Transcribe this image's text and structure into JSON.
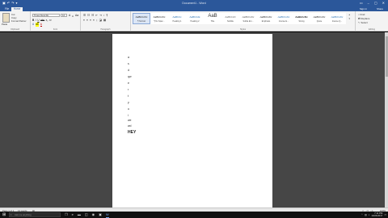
{
  "titlebar": {
    "title": "Document1 - Word",
    "qat_save_icon": "save-icon",
    "qat_undo_icon": "undo-icon",
    "qat_redo_icon": "redo-icon",
    "window_controls": [
      "–",
      "▢",
      "✕"
    ]
  },
  "tabs": {
    "file": "File",
    "home": "Home",
    "sign_in": "Sign in",
    "share": "Share"
  },
  "ribbon": {
    "clipboard": {
      "label": "Clipboard",
      "paste": "Paste",
      "cut": "Cut",
      "copy": "Copy",
      "format_painter": "Format Painter"
    },
    "font": {
      "label": "Font",
      "family": "Times New Ro",
      "size": "12",
      "bold": "B",
      "italic": "I",
      "underline": "U",
      "strike": "abc",
      "sub": "x₂",
      "sup": "x²",
      "text_effects": "A",
      "highlight": "ab",
      "font_color": "A"
    },
    "paragraph": {
      "label": "Paragraph"
    },
    "styles": {
      "label": "Styles",
      "items": [
        {
          "sample": "AaBbCcDc",
          "name": "¶ Normal"
        },
        {
          "sample": "AaBbCcDc",
          "name": "¶ No Spac..."
        },
        {
          "sample": "AaBbCc",
          "name": "Heading 1"
        },
        {
          "sample": "AaBbCcE",
          "name": "Heading 2"
        },
        {
          "sample": "AaB",
          "name": "Title"
        },
        {
          "sample": "AaBbCcD",
          "name": "Subtitle"
        },
        {
          "sample": "AaBbCcDc",
          "name": "Subtle Em..."
        },
        {
          "sample": "AaBbCcDc",
          "name": "Emphasis"
        },
        {
          "sample": "AaBbCcDc",
          "name": "Intense E..."
        },
        {
          "sample": "AaBbCcDc",
          "name": "Strong"
        },
        {
          "sample": "AaBbCcDc",
          "name": "Quote"
        },
        {
          "sample": "AaBbCcDc",
          "name": "Intense Q..."
        }
      ]
    },
    "editing": {
      "label": "Editing",
      "find": "Find",
      "replace": "Replace",
      "select": "Select"
    }
  },
  "document": {
    "lines": [
      "a",
      "s",
      "d",
      "qw",
      "e",
      "r",
      "t",
      "y",
      "u",
      "i",
      "we",
      "wd",
      "HEY"
    ]
  },
  "statusbar": {
    "page": "Page 1 of 1",
    "words": "13 words",
    "proofing_icon": "proofing-icon",
    "zoom": "100%"
  },
  "taskbar": {
    "search_placeholder": "Ask me anything",
    "time": "7:11 PM",
    "date": "10/24/2017"
  }
}
